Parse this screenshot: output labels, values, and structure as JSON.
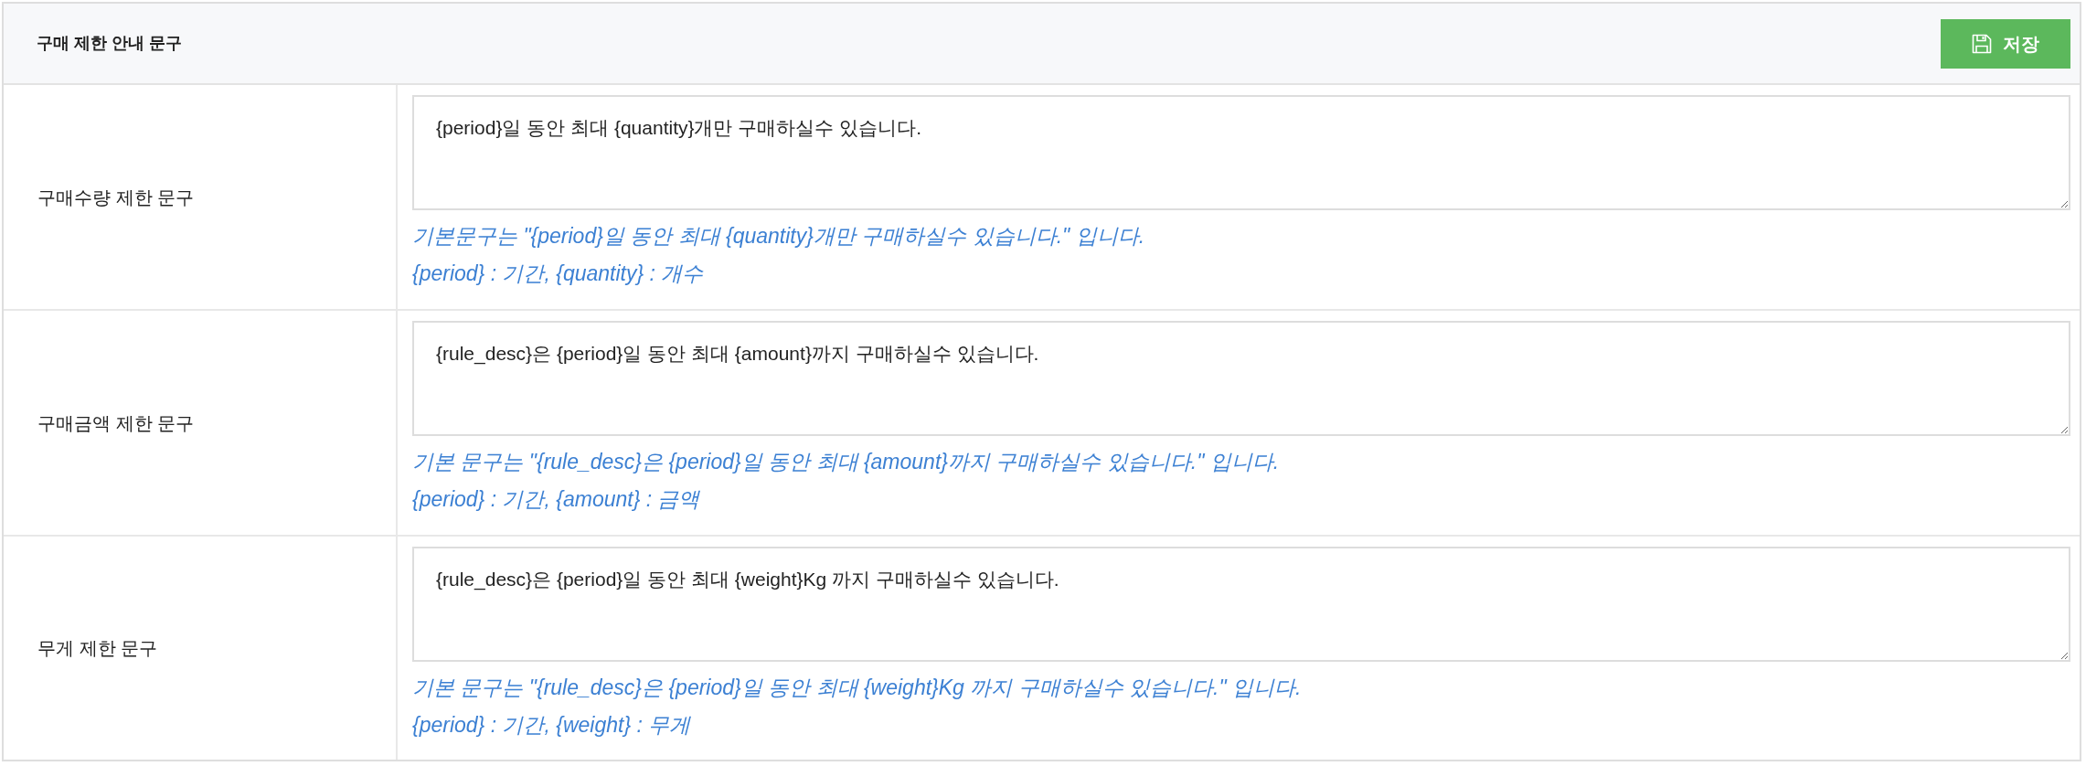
{
  "panel": {
    "title": "구매 제한 안내 문구",
    "save_button": {
      "label": "저장"
    }
  },
  "rows": [
    {
      "label": "구매수량 제한 문구",
      "value": "{period}일 동안 최대 {quantity}개만 구매하실수 있습니다.",
      "hint": "기본문구는 \"{period}일 동안 최대 {quantity}개만 구매하실수 있습니다.\" 입니다.",
      "variables": "{period} : 기간, {quantity} : 개수"
    },
    {
      "label": "구매금액 제한 문구",
      "value": "{rule_desc}은 {period}일 동안 최대 {amount}까지 구매하실수 있습니다.",
      "hint": "기본 문구는 \"{rule_desc}은 {period}일 동안 최대 {amount}까지 구매하실수 있습니다.\" 입니다.",
      "variables": "{period} : 기간, {amount} : 금액"
    },
    {
      "label": "무게 제한 문구",
      "value": "{rule_desc}은 {period}일 동안 최대 {weight}Kg 까지 구매하실수 있습니다.",
      "hint": "기본 문구는 \"{rule_desc}은 {period}일 동안 최대 {weight}Kg 까지 구매하실수 있습니다.\" 입니다.",
      "variables": "{period} : 기간, {weight} : 무게"
    }
  ]
}
